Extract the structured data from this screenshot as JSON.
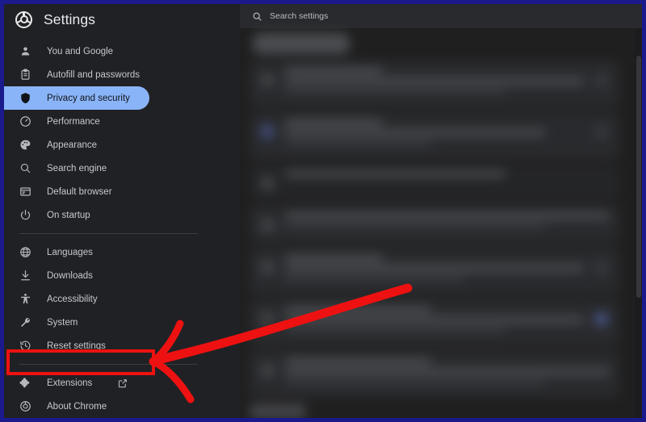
{
  "window": {
    "border_color": "#1a1a8c",
    "background": "#1f1f1f"
  },
  "brand": {
    "logo_icon": "chrome-logo-icon",
    "title": "Settings"
  },
  "search": {
    "icon": "search-icon",
    "placeholder": "Search settings",
    "value": ""
  },
  "sidebar": {
    "selected_index": 2,
    "selected_color": "#8ab4f8",
    "items": [
      {
        "label": "You and Google",
        "icon": "person-icon",
        "selected": false,
        "external": false
      },
      {
        "label": "Autofill and passwords",
        "icon": "clipboard-icon",
        "selected": false,
        "external": false
      },
      {
        "label": "Privacy and security",
        "icon": "shield-icon",
        "selected": true,
        "external": false
      },
      {
        "label": "Performance",
        "icon": "gauge-icon",
        "selected": false,
        "external": false
      },
      {
        "label": "Appearance",
        "icon": "palette-icon",
        "selected": false,
        "external": false
      },
      {
        "label": "Search engine",
        "icon": "magnifier-icon",
        "selected": false,
        "external": false
      },
      {
        "label": "Default browser",
        "icon": "browser-window-icon",
        "selected": false,
        "external": false
      },
      {
        "label": "On startup",
        "icon": "power-icon",
        "selected": false,
        "external": false
      },
      {
        "label": "Languages",
        "icon": "globe-icon",
        "selected": false,
        "external": false
      },
      {
        "label": "Downloads",
        "icon": "download-icon",
        "selected": false,
        "external": false
      },
      {
        "label": "Accessibility",
        "icon": "accessibility-icon",
        "selected": false,
        "external": false
      },
      {
        "label": "System",
        "icon": "wrench-icon",
        "selected": false,
        "external": false
      },
      {
        "label": "Reset settings",
        "icon": "history-clock-icon",
        "selected": false,
        "external": false
      },
      {
        "label": "Extensions",
        "icon": "puzzle-piece-icon",
        "selected": false,
        "external": true
      },
      {
        "label": "About Chrome",
        "icon": "chrome-logo-icon",
        "selected": false,
        "external": false
      }
    ],
    "dividers_after": [
      7,
      12
    ]
  },
  "annotation": {
    "highlight_target": "Extensions",
    "highlight_color": "#ee1111",
    "arrow_color": "#ee1111",
    "arrow_direction": "points-left-to-extensions"
  },
  "main": {
    "state": "blurred",
    "description": "Privacy and security settings page content (obscured)"
  }
}
